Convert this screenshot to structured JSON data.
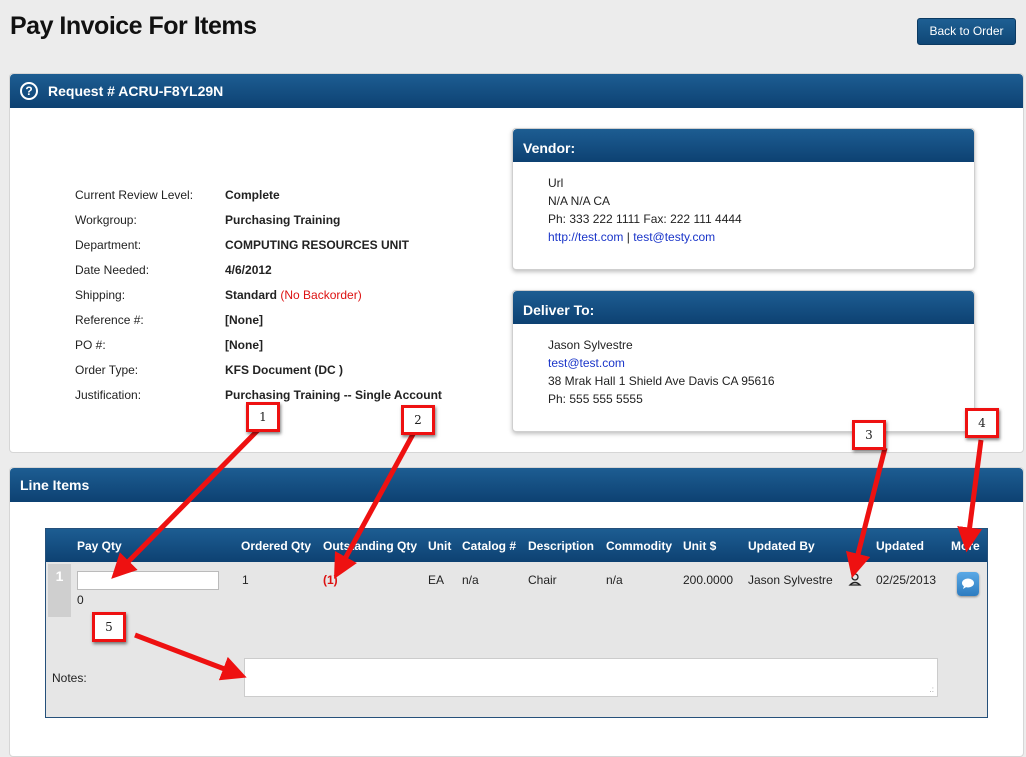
{
  "page": {
    "title": "Pay Invoice For Items",
    "back_button": "Back to Order"
  },
  "request": {
    "header": "Request # ACRU-F8YL29N",
    "help_icon": "?",
    "details": [
      {
        "label": "Current Review Level:",
        "value": "Complete"
      },
      {
        "label": "Workgroup:",
        "value": "Purchasing Training"
      },
      {
        "label": "Department:",
        "value": "COMPUTING RESOURCES UNIT"
      },
      {
        "label": "Date Needed:",
        "value": "4/6/2012"
      },
      {
        "label": "Shipping:",
        "value": "Standard",
        "note": "(No Backorder)"
      },
      {
        "label": "Reference #:",
        "value": "[None]"
      },
      {
        "label": "PO #:",
        "value": "[None]"
      },
      {
        "label": "Order Type:",
        "value": "KFS Document (DC )"
      },
      {
        "label": "Justification:",
        "value": "Purchasing Training -- Single Account"
      }
    ]
  },
  "vendor": {
    "header": "Vendor:",
    "name": "Url",
    "location": "N/A N/A CA",
    "phone": "Ph: 333 222 1111 Fax: 222 111 4444",
    "website": "http://test.com",
    "separator": "|",
    "email": "test@testy.com"
  },
  "deliver_to": {
    "header": "Deliver To:",
    "name": "Jason Sylvestre",
    "email": "test@test.com",
    "address": "38 Mrak Hall 1 Shield Ave Davis CA 95616",
    "phone": "Ph: 555 555 5555"
  },
  "line_items": {
    "header": "Line Items",
    "columns": [
      "Pay Qty",
      "Ordered Qty",
      "Outstanding Qty",
      "Unit",
      "Catalog #",
      "Description",
      "Commodity",
      "Unit $",
      "Updated By",
      "Updated",
      "More"
    ],
    "rows": [
      {
        "row_number": "1",
        "pay_qty": "",
        "pay_qty_below": "0",
        "ordered_qty": "1",
        "outstanding_qty": "(1)",
        "unit": "EA",
        "catalog": "n/a",
        "description": "Chair",
        "commodity": "n/a",
        "unit_price": "200.0000",
        "updated_by": "Jason Sylvestre",
        "updated": "02/25/2013"
      }
    ],
    "notes_label": "Notes:",
    "notes_value": ""
  },
  "callouts": [
    "1",
    "2",
    "3",
    "4",
    "5"
  ],
  "icons": {
    "help": "help-icon",
    "user": "user-icon",
    "more": "comment-bubble-icon",
    "resize": "resize-grip-icon"
  },
  "colors": {
    "header_blue": "#0d4172",
    "link": "#1a35c9",
    "alert_red": "#d11111",
    "callout_red": "#ee1111"
  }
}
